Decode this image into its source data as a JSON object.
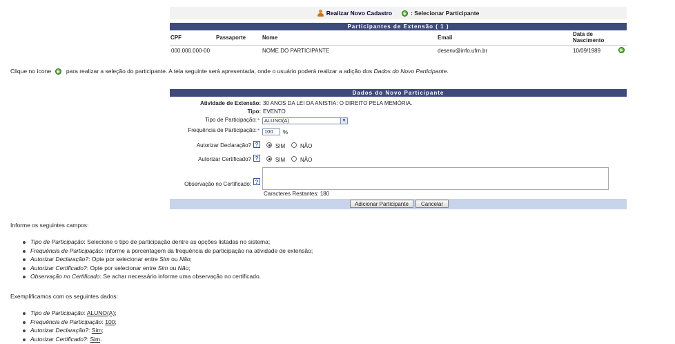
{
  "legend": {
    "new_label": "Realizar Novo Cadastro",
    "select_label": ": Selecionar Participante"
  },
  "participants": {
    "title": "Participantes de Extensão ( 1 )",
    "columns": [
      "CPF",
      "Passaporte",
      "Nome",
      "Email",
      "Data de Nascimento"
    ],
    "rows": [
      {
        "cpf": "000.000.000-00",
        "passaporte": "",
        "nome": "NOME DO PARTICIPANTE",
        "email": "desenv@info.ufrn.br",
        "nascimento": "10/09/1989"
      }
    ]
  },
  "instruction": {
    "part1": "Clique no ícone",
    "part2": "para realizar a seleção do participante. A tela seguinte será apresentada, onde o usuário poderá realizar a adição dos",
    "part3": "Dados do Novo Participante",
    "part4": "."
  },
  "form": {
    "title": "Dados do Novo Participante",
    "atividade_label": "Atividade de Extensão:",
    "atividade_value": "30 ANOS DA LEI DA ANISTIA: O DIREITO PELA MEMÓRIA.",
    "tipo_label": "Tipo:",
    "tipo_value": "EVENTO",
    "tipo_part_label": "Tipo de Participação:",
    "tipo_part_value": "ALUNO(A)",
    "frequencia_label": "Frequência de Participação:",
    "frequencia_value": "100",
    "percent": "%",
    "declaracao_label": "Autorizar Declaração?",
    "certificado_label": "Autorizar Certificado?",
    "sim": "SIM",
    "nao": "NÃO",
    "observacao_label": "Observação no Certificado:",
    "caracteres": "Caracteres Restantes: 180",
    "help": "?",
    "required": "*",
    "add_button": "Adicionar Participante",
    "cancel_button": "Cancelar"
  },
  "info": {
    "intro": "Informe os seguintes campos:",
    "items": [
      {
        "term": "Tipo de Participação",
        "text": ": Selecione o tipo de participação dentre as opções listadas no sistema;"
      },
      {
        "term": "Frequência de Participação",
        "text": ": Informe a porcentagem da frequência de participação na atividade de extensão;"
      },
      {
        "term": "Autorizar Declaração?",
        "text": ": Opte por selecionar entre ",
        "a": "Sim",
        "mid": " ou ",
        "b": "Não",
        "end": ";"
      },
      {
        "term": "Autorizar Certificado?",
        "text": ": Opte por selecionar entre ",
        "a": "Sim",
        "mid": " ou ",
        "b": "Não",
        "end": ";"
      },
      {
        "term": "Observação no Certificado",
        "text": ": Se achar necessário informe uma observação no certificado."
      }
    ]
  },
  "example": {
    "intro": "Exemplificamos com os seguintes dados:",
    "items": [
      {
        "term": "Tipo de Participação",
        "sep": ": ",
        "value": "ALUNO(A)",
        "end": ";"
      },
      {
        "term": "Frequência de Participação",
        "sep": ": ",
        "value": "100",
        "end": ";"
      },
      {
        "term": "Autorizar Declaração?",
        "sep": ": ",
        "value": "Sim",
        "end": ";"
      },
      {
        "term": "Autorizar Certificado?",
        "sep": ": ",
        "value": "Sim",
        "end": "."
      }
    ]
  }
}
